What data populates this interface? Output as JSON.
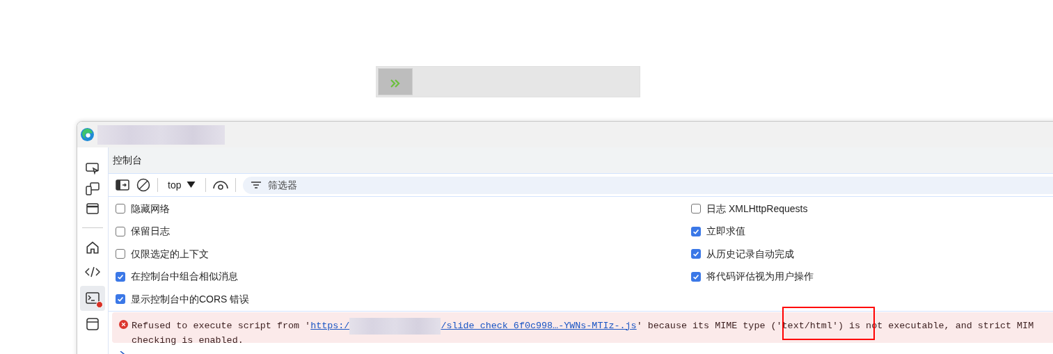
{
  "devtools": {
    "panel_title": "控制台",
    "toolbar": {
      "context": "top",
      "filter_placeholder": "筛选器"
    },
    "settings_left": [
      {
        "label": "隐藏网络",
        "checked": false
      },
      {
        "label": "保留日志",
        "checked": false
      },
      {
        "label": "仅限选定的上下文",
        "checked": false
      },
      {
        "label": "在控制台中组合相似消息",
        "checked": true
      },
      {
        "label": "显示控制台中的CORS 错误",
        "checked": true
      }
    ],
    "settings_right": [
      {
        "label": "日志 XMLHttpRequests",
        "checked": false
      },
      {
        "label": "立即求值",
        "checked": true
      },
      {
        "label": "从历史记录自动完成",
        "checked": true
      },
      {
        "label": "将代码评估视为用户操作",
        "checked": true
      }
    ],
    "error_message": {
      "before_link": "Refused to execute script from '",
      "link_start": "https:/",
      "link_end": "/slide_check_6f0c998…-YWNs-MTIz-.js",
      "after_link": "' because its MIME type ('text/html') is not executable, and strict MIM",
      "second_line": "checking is enabled."
    }
  }
}
